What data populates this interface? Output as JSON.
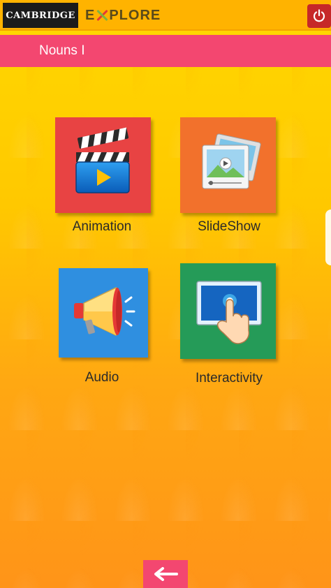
{
  "header": {
    "brand_left": "CAMBRIDGE",
    "brand_right_prefix": "E",
    "brand_right_suffix": "PLORE",
    "power_icon": "power-icon"
  },
  "titlebar": {
    "title": "Nouns I"
  },
  "tiles": [
    {
      "label": "Animation",
      "icon": "clapperboard-icon",
      "color": "#e84343"
    },
    {
      "label": "SlideShow",
      "icon": "slideshow-icon",
      "color": "#f2712c"
    },
    {
      "label": "Audio",
      "icon": "megaphone-icon",
      "color": "#2f8fe0"
    },
    {
      "label": "Interactivity",
      "icon": "touch-screen-icon",
      "color": "#259b58"
    }
  ],
  "footer": {
    "back_icon": "arrow-left-icon"
  },
  "colors": {
    "topbar": "#ffb300",
    "titlebar": "#f34770",
    "power_button": "#c62828"
  }
}
